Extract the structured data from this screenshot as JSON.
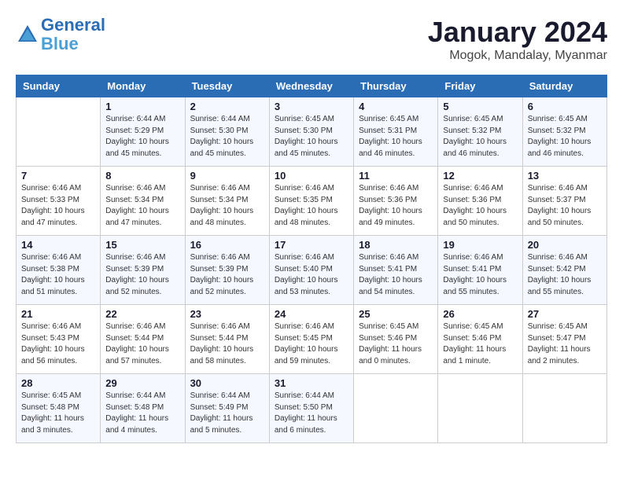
{
  "header": {
    "logo_line1": "General",
    "logo_line2": "Blue",
    "month_year": "January 2024",
    "location": "Mogok, Mandalay, Myanmar"
  },
  "days_of_week": [
    "Sunday",
    "Monday",
    "Tuesday",
    "Wednesday",
    "Thursday",
    "Friday",
    "Saturday"
  ],
  "weeks": [
    [
      {
        "day": "",
        "info": ""
      },
      {
        "day": "1",
        "info": "Sunrise: 6:44 AM\nSunset: 5:29 PM\nDaylight: 10 hours\nand 45 minutes."
      },
      {
        "day": "2",
        "info": "Sunrise: 6:44 AM\nSunset: 5:30 PM\nDaylight: 10 hours\nand 45 minutes."
      },
      {
        "day": "3",
        "info": "Sunrise: 6:45 AM\nSunset: 5:30 PM\nDaylight: 10 hours\nand 45 minutes."
      },
      {
        "day": "4",
        "info": "Sunrise: 6:45 AM\nSunset: 5:31 PM\nDaylight: 10 hours\nand 46 minutes."
      },
      {
        "day": "5",
        "info": "Sunrise: 6:45 AM\nSunset: 5:32 PM\nDaylight: 10 hours\nand 46 minutes."
      },
      {
        "day": "6",
        "info": "Sunrise: 6:45 AM\nSunset: 5:32 PM\nDaylight: 10 hours\nand 46 minutes."
      }
    ],
    [
      {
        "day": "7",
        "info": "Sunrise: 6:46 AM\nSunset: 5:33 PM\nDaylight: 10 hours\nand 47 minutes."
      },
      {
        "day": "8",
        "info": "Sunrise: 6:46 AM\nSunset: 5:34 PM\nDaylight: 10 hours\nand 47 minutes."
      },
      {
        "day": "9",
        "info": "Sunrise: 6:46 AM\nSunset: 5:34 PM\nDaylight: 10 hours\nand 48 minutes."
      },
      {
        "day": "10",
        "info": "Sunrise: 6:46 AM\nSunset: 5:35 PM\nDaylight: 10 hours\nand 48 minutes."
      },
      {
        "day": "11",
        "info": "Sunrise: 6:46 AM\nSunset: 5:36 PM\nDaylight: 10 hours\nand 49 minutes."
      },
      {
        "day": "12",
        "info": "Sunrise: 6:46 AM\nSunset: 5:36 PM\nDaylight: 10 hours\nand 50 minutes."
      },
      {
        "day": "13",
        "info": "Sunrise: 6:46 AM\nSunset: 5:37 PM\nDaylight: 10 hours\nand 50 minutes."
      }
    ],
    [
      {
        "day": "14",
        "info": "Sunrise: 6:46 AM\nSunset: 5:38 PM\nDaylight: 10 hours\nand 51 minutes."
      },
      {
        "day": "15",
        "info": "Sunrise: 6:46 AM\nSunset: 5:39 PM\nDaylight: 10 hours\nand 52 minutes."
      },
      {
        "day": "16",
        "info": "Sunrise: 6:46 AM\nSunset: 5:39 PM\nDaylight: 10 hours\nand 52 minutes."
      },
      {
        "day": "17",
        "info": "Sunrise: 6:46 AM\nSunset: 5:40 PM\nDaylight: 10 hours\nand 53 minutes."
      },
      {
        "day": "18",
        "info": "Sunrise: 6:46 AM\nSunset: 5:41 PM\nDaylight: 10 hours\nand 54 minutes."
      },
      {
        "day": "19",
        "info": "Sunrise: 6:46 AM\nSunset: 5:41 PM\nDaylight: 10 hours\nand 55 minutes."
      },
      {
        "day": "20",
        "info": "Sunrise: 6:46 AM\nSunset: 5:42 PM\nDaylight: 10 hours\nand 55 minutes."
      }
    ],
    [
      {
        "day": "21",
        "info": "Sunrise: 6:46 AM\nSunset: 5:43 PM\nDaylight: 10 hours\nand 56 minutes."
      },
      {
        "day": "22",
        "info": "Sunrise: 6:46 AM\nSunset: 5:44 PM\nDaylight: 10 hours\nand 57 minutes."
      },
      {
        "day": "23",
        "info": "Sunrise: 6:46 AM\nSunset: 5:44 PM\nDaylight: 10 hours\nand 58 minutes."
      },
      {
        "day": "24",
        "info": "Sunrise: 6:46 AM\nSunset: 5:45 PM\nDaylight: 10 hours\nand 59 minutes."
      },
      {
        "day": "25",
        "info": "Sunrise: 6:45 AM\nSunset: 5:46 PM\nDaylight: 11 hours\nand 0 minutes."
      },
      {
        "day": "26",
        "info": "Sunrise: 6:45 AM\nSunset: 5:46 PM\nDaylight: 11 hours\nand 1 minute."
      },
      {
        "day": "27",
        "info": "Sunrise: 6:45 AM\nSunset: 5:47 PM\nDaylight: 11 hours\nand 2 minutes."
      }
    ],
    [
      {
        "day": "28",
        "info": "Sunrise: 6:45 AM\nSunset: 5:48 PM\nDaylight: 11 hours\nand 3 minutes."
      },
      {
        "day": "29",
        "info": "Sunrise: 6:44 AM\nSunset: 5:48 PM\nDaylight: 11 hours\nand 4 minutes."
      },
      {
        "day": "30",
        "info": "Sunrise: 6:44 AM\nSunset: 5:49 PM\nDaylight: 11 hours\nand 5 minutes."
      },
      {
        "day": "31",
        "info": "Sunrise: 6:44 AM\nSunset: 5:50 PM\nDaylight: 11 hours\nand 6 minutes."
      },
      {
        "day": "",
        "info": ""
      },
      {
        "day": "",
        "info": ""
      },
      {
        "day": "",
        "info": ""
      }
    ]
  ]
}
